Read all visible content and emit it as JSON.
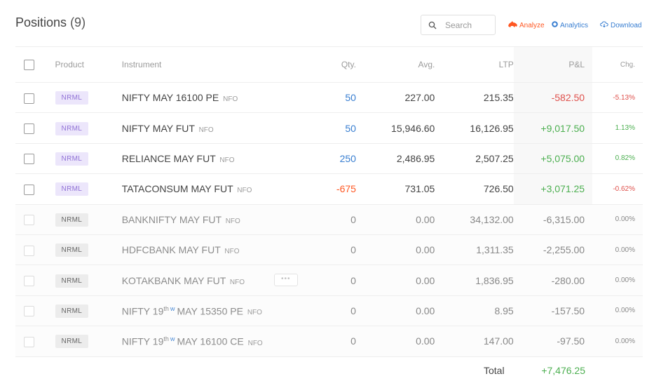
{
  "header": {
    "title": "Positions",
    "count": "(9)",
    "search_placeholder": "Search",
    "analyze_label": "Analyze",
    "analytics_label": "Analytics",
    "download_label": "Download"
  },
  "columns": {
    "product": "Product",
    "instrument": "Instrument",
    "qty": "Qty.",
    "avg": "Avg.",
    "ltp": "LTP",
    "pnl": "P&L",
    "chg": "Chg."
  },
  "rows": [
    {
      "product": "NRML",
      "instrument": "NIFTY MAY 16100 PE",
      "exchange": "NFO",
      "qty": "50",
      "avg": "227.00",
      "ltp": "215.35",
      "pnl": "-582.50",
      "chg": "-5.13%",
      "closed": false
    },
    {
      "product": "NRML",
      "instrument": "NIFTY MAY FUT",
      "exchange": "NFO",
      "qty": "50",
      "avg": "15,946.60",
      "ltp": "16,126.95",
      "pnl": "+9,017.50",
      "chg": "1.13%",
      "closed": false
    },
    {
      "product": "NRML",
      "instrument": "RELIANCE MAY FUT",
      "exchange": "NFO",
      "qty": "250",
      "avg": "2,486.95",
      "ltp": "2,507.25",
      "pnl": "+5,075.00",
      "chg": "0.82%",
      "closed": false
    },
    {
      "product": "NRML",
      "instrument": "TATACONSUM MAY FUT",
      "exchange": "NFO",
      "qty": "-675",
      "avg": "731.05",
      "ltp": "726.50",
      "pnl": "+3,071.25",
      "chg": "-0.62%",
      "closed": false
    },
    {
      "product": "NRML",
      "instrument": "BANKNIFTY MAY FUT",
      "exchange": "NFO",
      "qty": "0",
      "avg": "0.00",
      "ltp": "34,132.00",
      "pnl": "-6,315.00",
      "chg": "0.00%",
      "closed": true
    },
    {
      "product": "NRML",
      "instrument": "HDFCBANK MAY FUT",
      "exchange": "NFO",
      "qty": "0",
      "avg": "0.00",
      "ltp": "1,311.35",
      "pnl": "-2,255.00",
      "chg": "0.00%",
      "closed": true
    },
    {
      "product": "NRML",
      "instrument": "KOTAKBANK MAY FUT",
      "exchange": "NFO",
      "qty": "0",
      "avg": "0.00",
      "ltp": "1,836.95",
      "pnl": "-280.00",
      "chg": "0.00%",
      "closed": true,
      "more": "•••"
    },
    {
      "product": "NRML",
      "instrument_pre": "NIFTY 19",
      "instrument_sup": "th",
      "weekly": "W",
      "instrument_post": "MAY 15350 PE",
      "exchange": "NFO",
      "qty": "0",
      "avg": "0.00",
      "ltp": "8.95",
      "pnl": "-157.50",
      "chg": "0.00%",
      "closed": true
    },
    {
      "product": "NRML",
      "instrument_pre": "NIFTY 19",
      "instrument_sup": "th",
      "weekly": "W",
      "instrument_post": "MAY 16100 CE",
      "exchange": "NFO",
      "qty": "0",
      "avg": "0.00",
      "ltp": "147.00",
      "pnl": "-97.50",
      "chg": "0.00%",
      "closed": true
    }
  ],
  "footer": {
    "total_label": "Total",
    "total_value": "+7,476.25"
  },
  "colors": {
    "profit": "#4caf50",
    "loss": "#df514c",
    "accent_blue": "#387ed1",
    "analyze_orange": "#ff5722",
    "badge_purple": "#9173d6"
  }
}
